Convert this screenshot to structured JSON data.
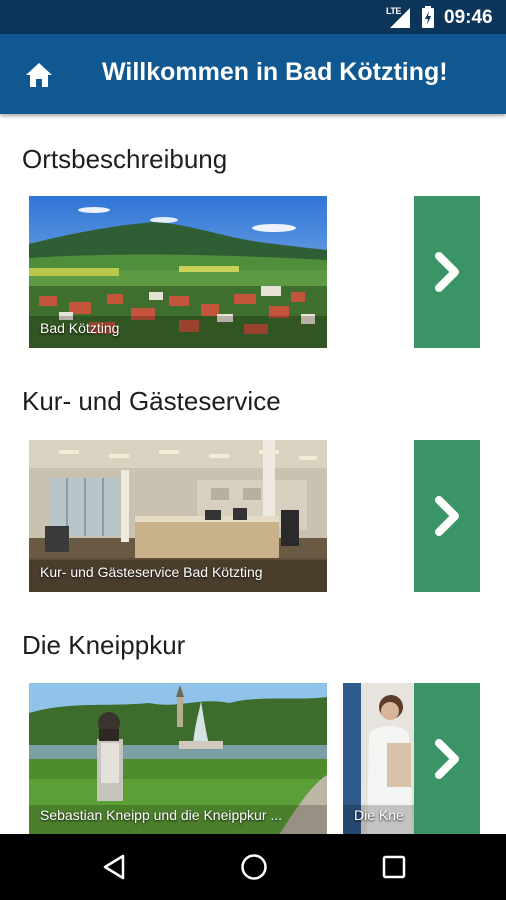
{
  "status_bar": {
    "network": "LTE",
    "time": "09:46",
    "icons": [
      "lte-icon",
      "signal-icon",
      "battery-charging-icon"
    ]
  },
  "app_bar": {
    "home_icon": "home-icon",
    "title": "Willkommen in Bad Kötzting!"
  },
  "sections": [
    {
      "title": "Ortsbeschreibung",
      "cards": [
        {
          "caption": "Bad Kötzting"
        }
      ]
    },
    {
      "title": "Kur- und Gästeservice",
      "cards": [
        {
          "caption": "Kur- und Gästeservice Bad Kötzting"
        }
      ]
    },
    {
      "title": "Die Kneippkur",
      "cards": [
        {
          "caption": "Sebastian Kneipp und die Kneippkur ..."
        },
        {
          "caption": "Die Kne"
        }
      ]
    }
  ],
  "colors": {
    "status_bar": "#0d3559",
    "app_bar": "#0f5891",
    "next_button": "#3a9465",
    "nav_bar": "#000000"
  },
  "nav_bar": {
    "icons": [
      "back-icon",
      "home-circle-icon",
      "recents-icon"
    ]
  }
}
